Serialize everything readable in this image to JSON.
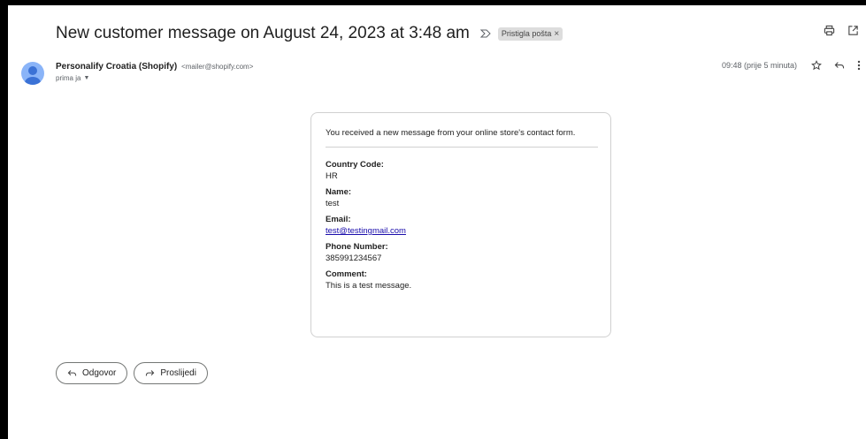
{
  "email": {
    "subject": "New customer message on August 24, 2023 at 3:48 am",
    "label": "Pristigla pošta",
    "label_remove": "×",
    "sender_name": "Personalify Croatia (Shopify)",
    "sender_email": "<mailer@shopify.com>",
    "recipient": "prima ja",
    "time": "09:48 (prije 5 minuta)"
  },
  "body": {
    "intro": "You received a new message from your online store's contact form.",
    "fields": [
      {
        "label": "Country Code:",
        "value": "HR"
      },
      {
        "label": "Name:",
        "value": "test"
      },
      {
        "label": "Email:",
        "value": "test@testingmail.com"
      },
      {
        "label": "Phone Number:",
        "value": "385991234567"
      },
      {
        "label": "Comment:",
        "value": "This is a test message."
      }
    ]
  },
  "actions": {
    "reply_label": "Odgovor",
    "forward_label": "Proslijedi"
  },
  "colors": {
    "avatar": "#8ab4f8",
    "link": "#1a0dab",
    "label_chip": "#dddddd"
  }
}
